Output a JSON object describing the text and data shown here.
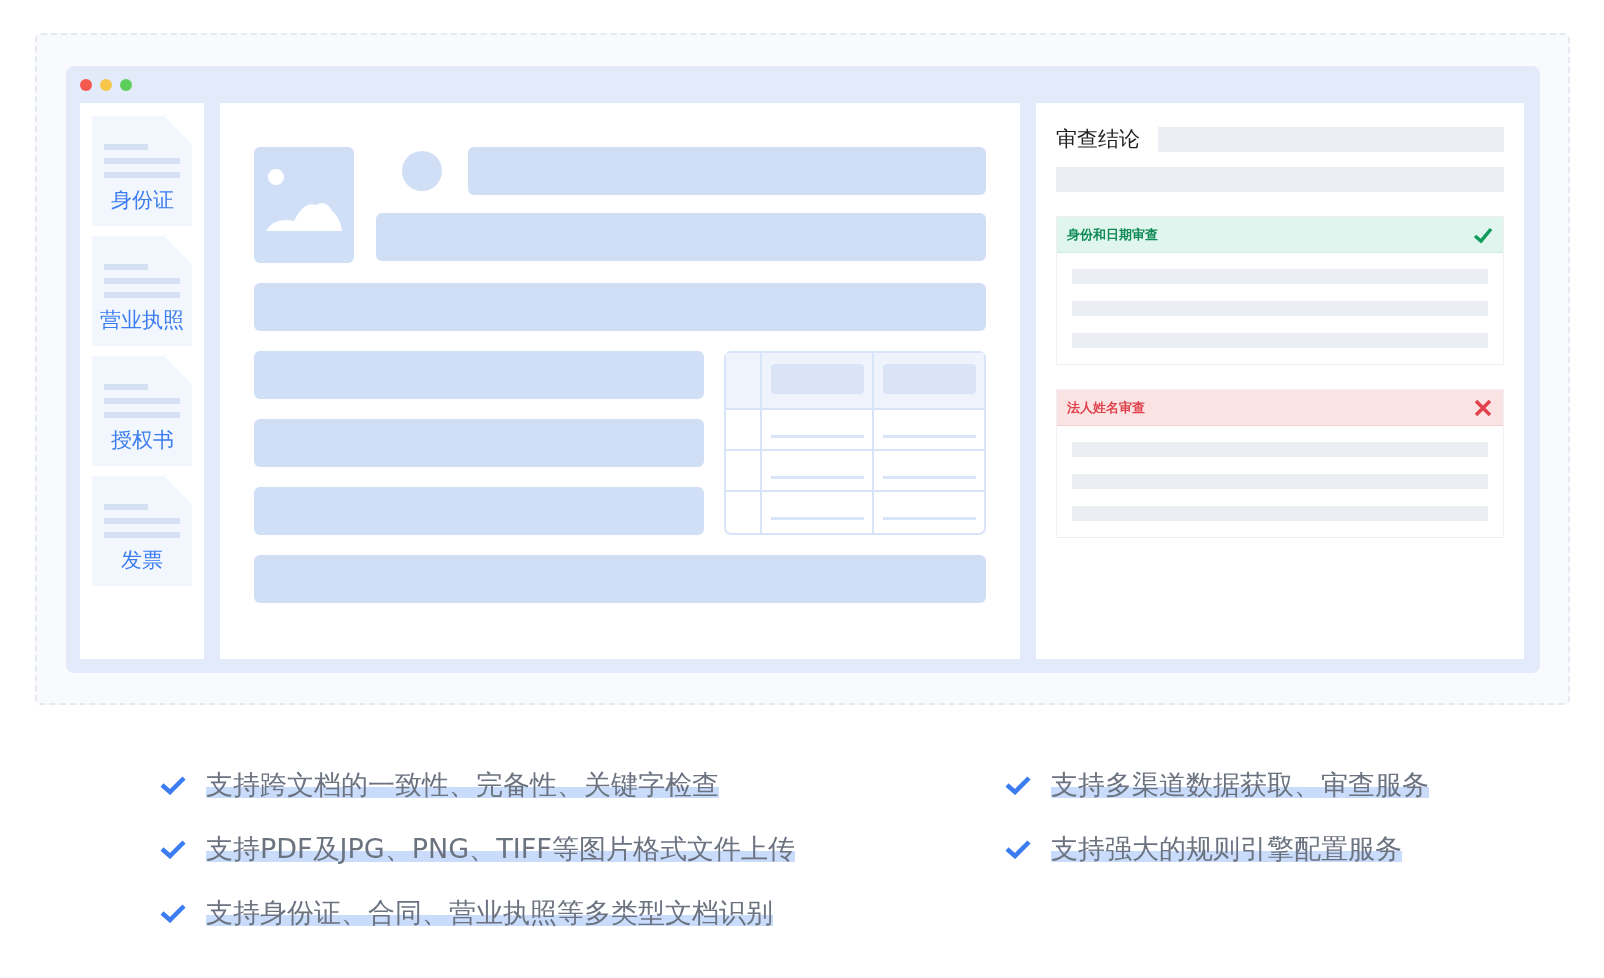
{
  "documents": [
    {
      "label": "身份证"
    },
    {
      "label": "营业执照"
    },
    {
      "label": "授权书"
    },
    {
      "label": "发票"
    }
  ],
  "review": {
    "title": "审查结论",
    "checks": [
      {
        "label": "身份和日期审查",
        "passed": true
      },
      {
        "label": "法人姓名审查",
        "passed": false
      }
    ]
  },
  "features_left": [
    "支持跨文档的一致性、完备性、关键字检查",
    "支持PDF及JPG、PNG、TIFF等图片格式文件上传",
    "支持身份证、合同、营业执照等多类型文档识别"
  ],
  "features_right": [
    "支持多渠道数据获取、审查服务",
    "支持强大的规则引擎配置服务"
  ]
}
